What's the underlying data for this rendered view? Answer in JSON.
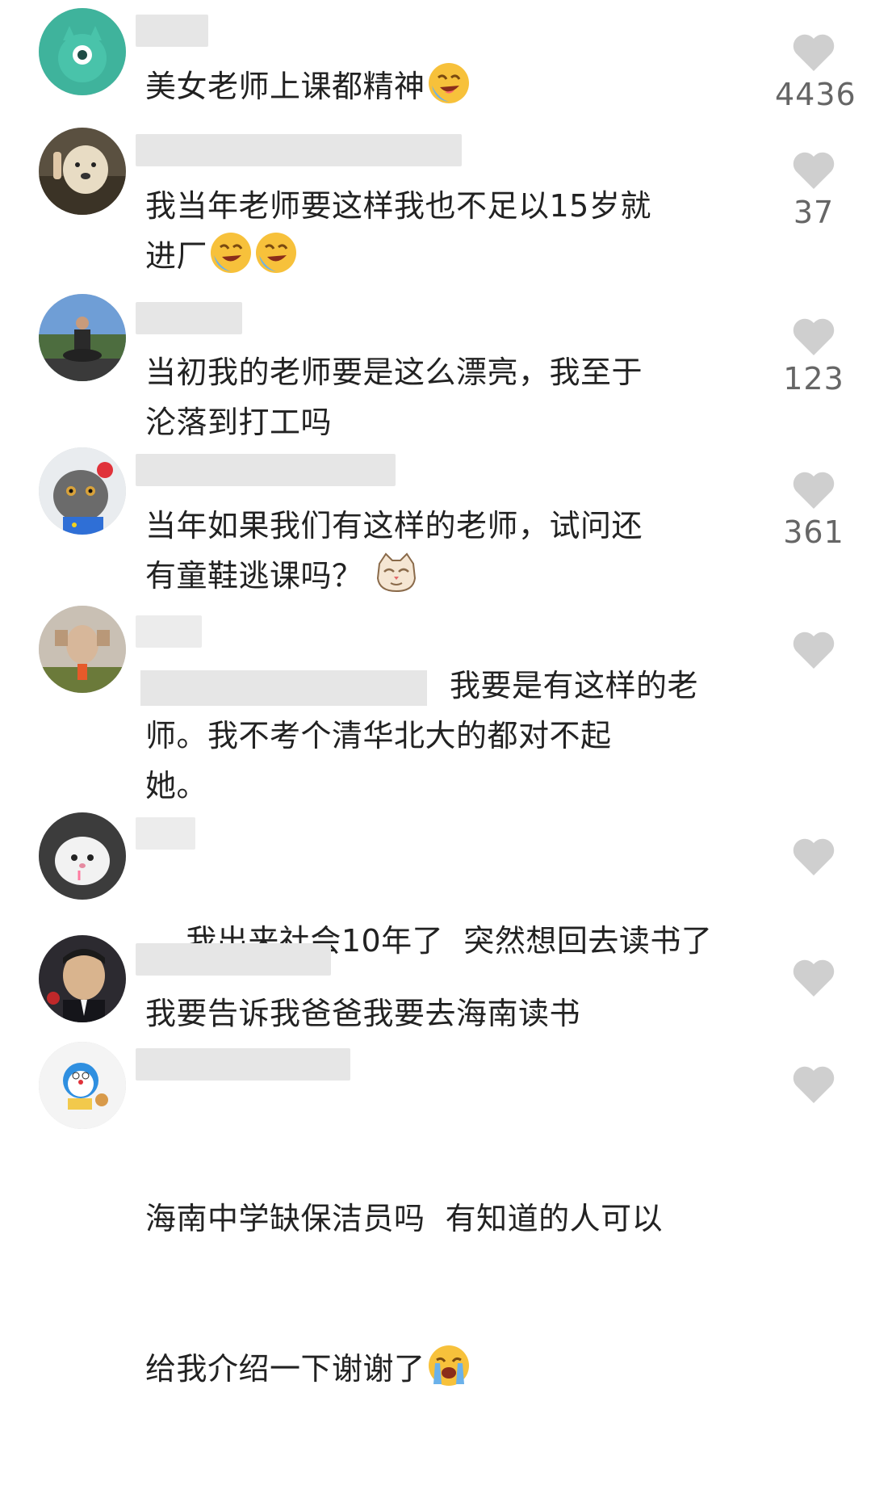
{
  "colors": {
    "heart": "#cfcfcf",
    "count": "#666666",
    "text": "#222222",
    "blur": "#e6e6e6"
  },
  "comments": [
    {
      "text": "美女老师上课都精神",
      "emoji": "laugh-cry-emoji",
      "likes": "4436"
    },
    {
      "text_1": "我当年老师要这样我也不足以15岁就",
      "text_2": "进厂",
      "emoji": "laugh-cry-emoji",
      "likes": "37"
    },
    {
      "text_1": "当初我的老师要是这么漂亮，我至于",
      "text_2": "沦落到打工吗",
      "likes": "123"
    },
    {
      "text_1": "当年如果我们有这样的老师，试问还",
      "text_2": "有童鞋逃课吗？",
      "emoji": "cat-emoji",
      "likes": "361"
    },
    {
      "text_1": "我要是有这样的老",
      "text_2": "师。我不考个清华北大的都对不起",
      "text_3": "她。",
      "likes": ""
    },
    {
      "text": "我出来社会10年了  突然想回去读书了",
      "likes": ""
    },
    {
      "text": "我要告诉我爸爸我要去海南读书",
      "likes": ""
    },
    {
      "text_1": "海南中学缺保洁员吗  有知道的人可以",
      "text_2": "给我介绍一下谢谢了",
      "emoji": "crying-emoji",
      "likes": ""
    }
  ]
}
